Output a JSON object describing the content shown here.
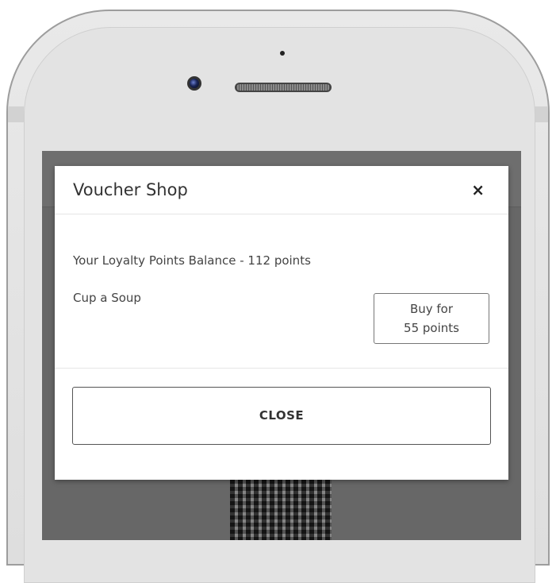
{
  "modal": {
    "title": "Voucher Shop",
    "close_icon": "×",
    "balance_text": "Your Loyalty Points Balance - 112 points",
    "voucher": {
      "name": "Cup a Soup",
      "buy_label_line1": "Buy for",
      "buy_label_line2": "55 points"
    },
    "close_button_label": "CLOSE"
  },
  "icons": {
    "close": "close-x-icon",
    "camera": "front-camera-icon",
    "speaker": "earpiece-speaker-icon"
  },
  "colors": {
    "overlay": "#676767",
    "modal_bg": "#ffffff",
    "text": "#333333",
    "border": "#777777"
  }
}
